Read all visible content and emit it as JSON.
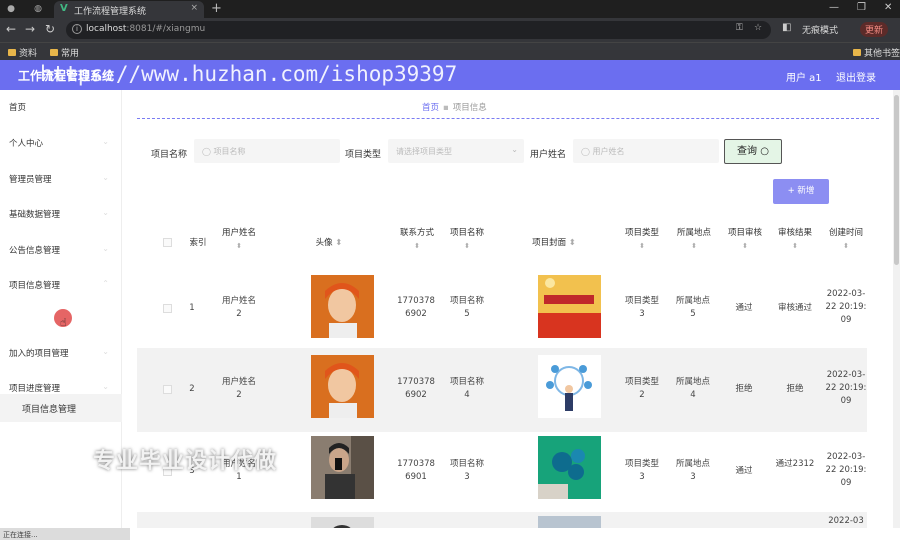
{
  "browser": {
    "tab_title": "工作流程管理系统",
    "tab_icon": "vue-logo-icon",
    "url_host": "localhost",
    "url_rest": ":8081/#/xiangmu",
    "incognito": "无痕模式",
    "update": "更新",
    "bookmarks": [
      "资料",
      "常用"
    ],
    "other_bookmarks": "其他书签"
  },
  "header": {
    "title": "工作流程管理系统",
    "user": "用户 a1",
    "logout": "退出登录",
    "color": "#6b6ef0"
  },
  "watermark": "https://www.huzhan.com/ishop39397",
  "sidebar": {
    "items": [
      "首页",
      "个人中心",
      "管理员管理",
      "基础数据管理",
      "公告信息管理",
      "项目信息管理"
    ],
    "sub_item": "项目信息管理",
    "items_after": [
      "加入的项目管理",
      "项目进度管理"
    ]
  },
  "breadcrumb": {
    "home": "首页",
    "current": "项目信息"
  },
  "filters": {
    "project_name_label": "项目名称",
    "project_name_placeholder": "项目名称",
    "project_type_label": "项目类型",
    "project_type_placeholder": "请选择项目类型",
    "user_name_label": "用户姓名",
    "user_name_placeholder": "用户姓名",
    "query": "查询"
  },
  "add_button": "+ 新增",
  "table": {
    "headers": [
      "索引",
      "用户姓名",
      "头像",
      "联系方式",
      "项目名称",
      "项目封面",
      "项目类型",
      "所属地点",
      "项目审核",
      "审核结果",
      "创建时间"
    ],
    "rows": [
      {
        "index": "1",
        "user": "用户姓名 2",
        "phone": "17703786902",
        "project": "项目名称 5",
        "type": "项目类型 3",
        "place": "所属地点 5",
        "audit": "通过",
        "result": "审核通过",
        "time": "2022-03-22 20:19:09"
      },
      {
        "index": "2",
        "user": "用户姓名 2",
        "phone": "17703786902",
        "project": "项目名称 4",
        "type": "项目类型 2",
        "place": "所属地点 4",
        "audit": "拒绝",
        "result": "拒绝",
        "time": "2022-03-22 20:19:09"
      },
      {
        "index": "3",
        "user": "用户姓名 1",
        "phone": "17703786901",
        "project": "项目名称 3",
        "type": "项目类型 3",
        "place": "所属地点 3",
        "audit": "通过",
        "result": "通过2312",
        "time": "2022-03-22 20:19:09"
      },
      {
        "time_partial": "2022-03"
      }
    ]
  },
  "promo_text": "专业毕业设计代做",
  "status_text": "正在连接..."
}
